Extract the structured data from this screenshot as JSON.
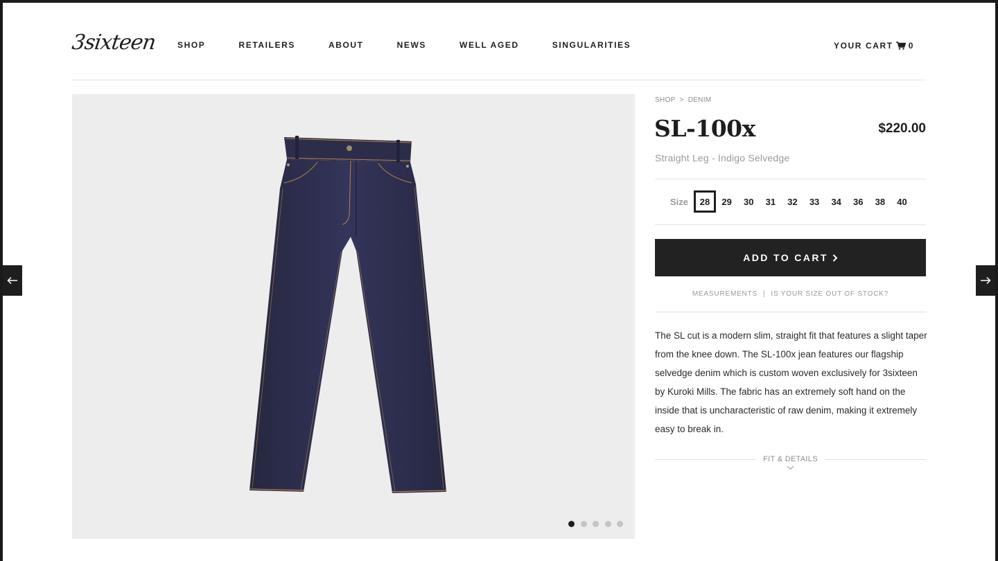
{
  "brand": {
    "logo_text": "3sixteen"
  },
  "nav": {
    "items": [
      "SHOP",
      "RETAILERS",
      "ABOUT",
      "NEWS",
      "WELL AGED",
      "SINGULARITIES"
    ]
  },
  "cart": {
    "label": "YOUR CART",
    "icon": "cart-icon",
    "count": "0"
  },
  "breadcrumb": {
    "items": [
      "SHOP",
      "DENIM"
    ],
    "separator": ">"
  },
  "product": {
    "title": "SL-100x",
    "price": "$220.00",
    "subtitle": "Straight Leg - Indigo Selvedge",
    "size_label": "Size",
    "sizes": [
      "28",
      "29",
      "30",
      "31",
      "32",
      "33",
      "34",
      "36",
      "38",
      "40"
    ],
    "selected_size": "28",
    "add_to_cart_label": "ADD TO CART",
    "measurements_label": "MEASUREMENTS",
    "stock_label": "IS YOUR SIZE OUT OF STOCK?",
    "description": "The SL cut is a modern slim, straight fit that features a slight taper from the knee down. The SL-100x jean features our flagship selvedge denim which is custom woven exclusively for 3sixteen by Kuroki Mills. The fabric has an extremely soft hand on the inside that is uncharacteristic of raw denim, making it extremely easy to break in.",
    "fit_details_label": "FIT & DETAILS"
  },
  "gallery": {
    "image_count": 5,
    "active_index": 0
  },
  "colors": {
    "accent": "#222222",
    "muted": "#9a9a9a",
    "gallery_bg": "#ededed",
    "denim": "#2e2f4e",
    "stitch": "#b8834a"
  }
}
